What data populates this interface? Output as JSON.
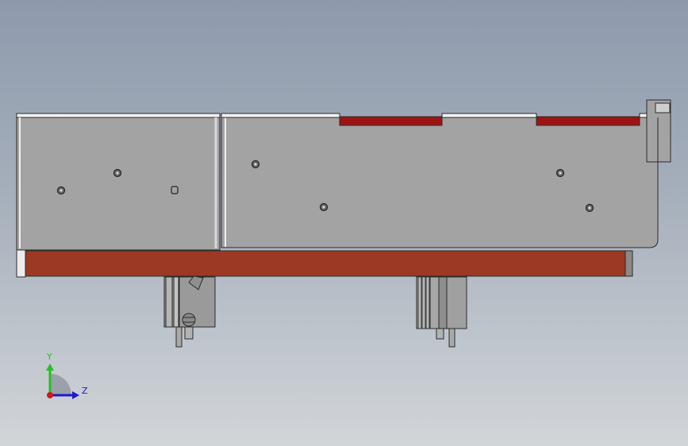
{
  "viewport": {
    "background_top": "#8e9aac",
    "background_bottom": "#d2d5d8"
  },
  "model": {
    "body_color": "#a3a3a3",
    "base_color": "#9b3924",
    "accent_color": "#9e1414",
    "edge_color": "#2b2b2b"
  },
  "triad": {
    "y_label": "Y",
    "z_label": "Z",
    "y_color": "#25c025",
    "z_color": "#1a1ad0",
    "x_color": "#d01a1a"
  }
}
